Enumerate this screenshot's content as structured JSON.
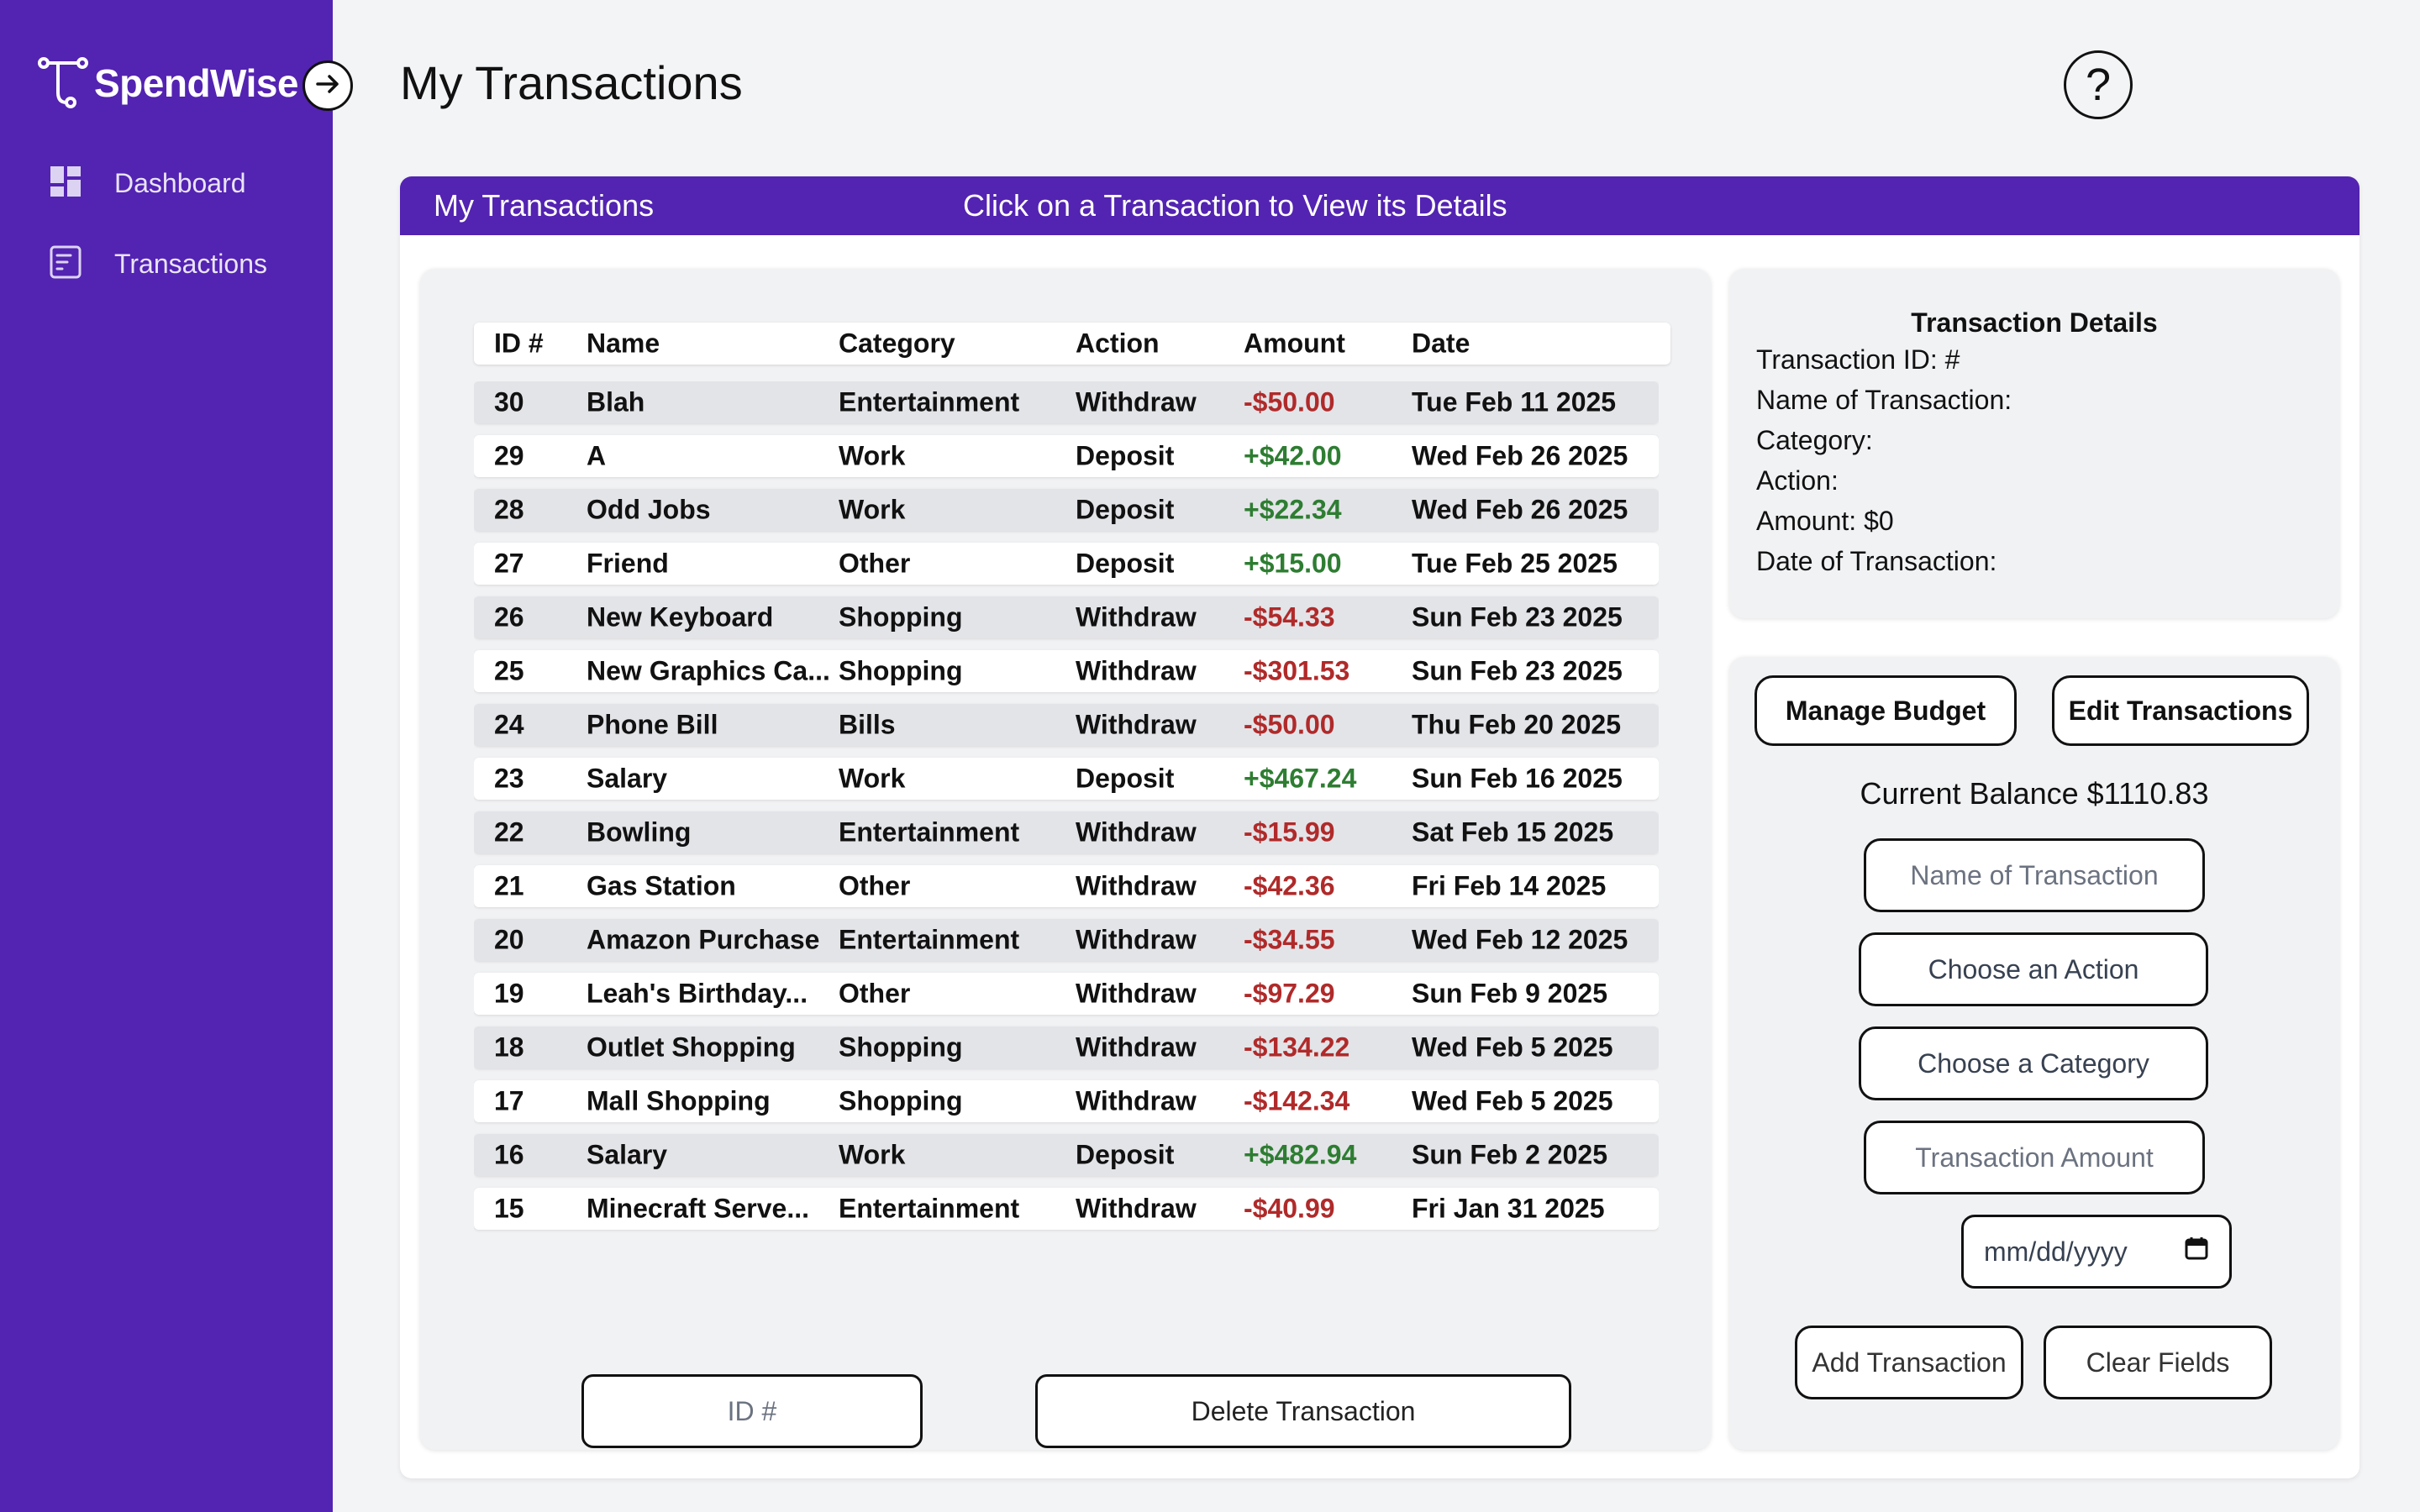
{
  "app": {
    "name": "SpendWise"
  },
  "sidebar": {
    "items": [
      {
        "label": "Dashboard",
        "icon": "dashboard-icon"
      },
      {
        "label": "Transactions",
        "icon": "transactions-icon"
      }
    ]
  },
  "header": {
    "title": "My Transactions",
    "help_label": "?"
  },
  "card": {
    "title": "My Transactions",
    "subtitle": "Click on a Transaction to View its Details"
  },
  "table": {
    "columns": [
      "ID #",
      "Name",
      "Category",
      "Action",
      "Amount",
      "Date"
    ],
    "rows": [
      {
        "id": "30",
        "name": "Blah",
        "category": "Entertainment",
        "action": "Withdraw",
        "amount": "-$50.00",
        "date": "Tue Feb 11 2025"
      },
      {
        "id": "29",
        "name": "A",
        "category": "Work",
        "action": "Deposit",
        "amount": "+$42.00",
        "date": "Wed Feb 26 2025"
      },
      {
        "id": "28",
        "name": "Odd Jobs",
        "category": "Work",
        "action": "Deposit",
        "amount": "+$22.34",
        "date": "Wed Feb 26 2025"
      },
      {
        "id": "27",
        "name": "Friend",
        "category": "Other",
        "action": "Deposit",
        "amount": "+$15.00",
        "date": "Tue Feb 25 2025"
      },
      {
        "id": "26",
        "name": "New Keyboard",
        "category": "Shopping",
        "action": "Withdraw",
        "amount": "-$54.33",
        "date": "Sun Feb 23 2025"
      },
      {
        "id": "25",
        "name": "New Graphics Ca...",
        "category": "Shopping",
        "action": "Withdraw",
        "amount": "-$301.53",
        "date": "Sun Feb 23 2025"
      },
      {
        "id": "24",
        "name": "Phone Bill",
        "category": "Bills",
        "action": "Withdraw",
        "amount": "-$50.00",
        "date": "Thu Feb 20 2025"
      },
      {
        "id": "23",
        "name": "Salary",
        "category": "Work",
        "action": "Deposit",
        "amount": "+$467.24",
        "date": "Sun Feb 16 2025"
      },
      {
        "id": "22",
        "name": "Bowling",
        "category": "Entertainment",
        "action": "Withdraw",
        "amount": "-$15.99",
        "date": "Sat Feb 15 2025"
      },
      {
        "id": "21",
        "name": "Gas Station",
        "category": "Other",
        "action": "Withdraw",
        "amount": "-$42.36",
        "date": "Fri Feb 14 2025"
      },
      {
        "id": "20",
        "name": "Amazon Purchase",
        "category": "Entertainment",
        "action": "Withdraw",
        "amount": "-$34.55",
        "date": "Wed Feb 12 2025"
      },
      {
        "id": "19",
        "name": "Leah's Birthday...",
        "category": "Other",
        "action": "Withdraw",
        "amount": "-$97.29",
        "date": "Sun Feb 9 2025"
      },
      {
        "id": "18",
        "name": "Outlet Shopping",
        "category": "Shopping",
        "action": "Withdraw",
        "amount": "-$134.22",
        "date": "Wed Feb 5 2025"
      },
      {
        "id": "17",
        "name": "Mall Shopping",
        "category": "Shopping",
        "action": "Withdraw",
        "amount": "-$142.34",
        "date": "Wed Feb 5 2025"
      },
      {
        "id": "16",
        "name": "Salary",
        "category": "Work",
        "action": "Deposit",
        "amount": "+$482.94",
        "date": "Sun Feb 2 2025"
      },
      {
        "id": "15",
        "name": "Minecraft Serve...",
        "category": "Entertainment",
        "action": "Withdraw",
        "amount": "-$40.99",
        "date": "Fri Jan 31 2025"
      }
    ],
    "id_placeholder": "ID #",
    "delete_label": "Delete Transaction"
  },
  "details": {
    "title": "Transaction Details",
    "lines": [
      "Transaction ID: #",
      "Name of Transaction:",
      "Category:",
      "Action:",
      "Amount: $0",
      "Date of Transaction:"
    ]
  },
  "actions": {
    "manage_budget_label": "Manage Budget",
    "edit_transactions_label": "Edit Transactions",
    "balance_text": "Current Balance $1110.83",
    "name_placeholder": "Name of Transaction",
    "action_select": "Choose an Action",
    "category_select": "Choose a Category",
    "amount_placeholder": "Transaction Amount",
    "date_placeholder": "mm/dd/yyyy",
    "add_label": "Add Transaction",
    "clear_label": "Clear Fields"
  },
  "colors": {
    "brand": "#5323b1",
    "negative": "#b02a2a",
    "positive": "#2e7d32"
  }
}
